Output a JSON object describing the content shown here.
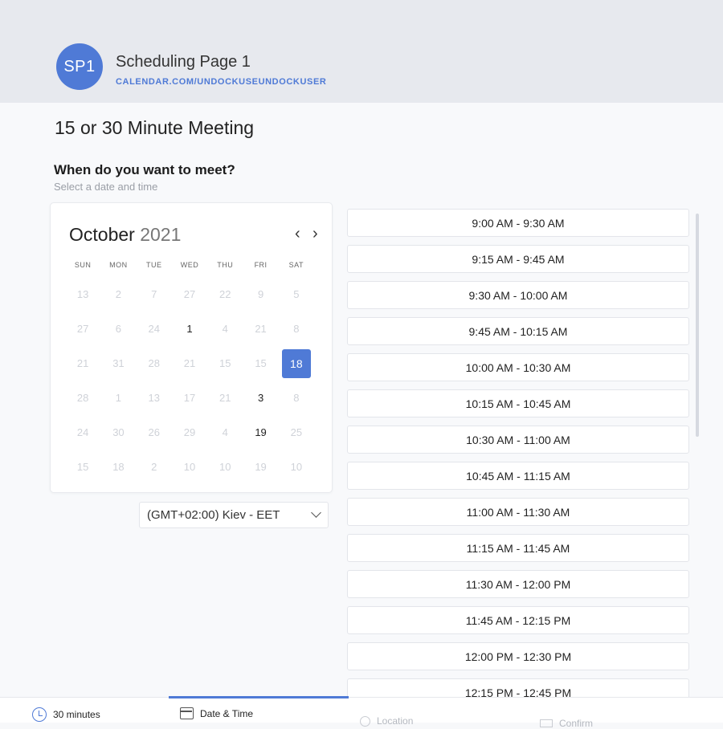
{
  "header": {
    "avatar_initials": "SP1",
    "page_name": "Scheduling Page 1",
    "page_url": "CALENDAR.COM/UNDOCKUSEUNDOCKUSER"
  },
  "meeting": {
    "title": "15 or 30 Minute Meeting",
    "question": "When do you want to meet?",
    "subtitle": "Select a date and time"
  },
  "calendar": {
    "month": "October",
    "year": "2021",
    "weekdays": [
      "SUN",
      "MON",
      "TUE",
      "WED",
      "THU",
      "FRI",
      "SAT"
    ],
    "weeks": [
      [
        {
          "d": "13",
          "s": "off"
        },
        {
          "d": "2",
          "s": "off"
        },
        {
          "d": "7",
          "s": "off"
        },
        {
          "d": "27",
          "s": "off"
        },
        {
          "d": "22",
          "s": "off"
        },
        {
          "d": "9",
          "s": "off"
        },
        {
          "d": "5",
          "s": "off"
        }
      ],
      [
        {
          "d": "27",
          "s": "off"
        },
        {
          "d": "6",
          "s": "off"
        },
        {
          "d": "24",
          "s": "off"
        },
        {
          "d": "1",
          "s": "avail"
        },
        {
          "d": "4",
          "s": "off"
        },
        {
          "d": "21",
          "s": "off"
        },
        {
          "d": "8",
          "s": "off"
        }
      ],
      [
        {
          "d": "21",
          "s": "off"
        },
        {
          "d": "31",
          "s": "off"
        },
        {
          "d": "28",
          "s": "off"
        },
        {
          "d": "21",
          "s": "off"
        },
        {
          "d": "15",
          "s": "off"
        },
        {
          "d": "15",
          "s": "off"
        },
        {
          "d": "18",
          "s": "selected"
        }
      ],
      [
        {
          "d": "28",
          "s": "off"
        },
        {
          "d": "1",
          "s": "off"
        },
        {
          "d": "13",
          "s": "off"
        },
        {
          "d": "17",
          "s": "off"
        },
        {
          "d": "21",
          "s": "off"
        },
        {
          "d": "3",
          "s": "avail"
        },
        {
          "d": "8",
          "s": "off"
        }
      ],
      [
        {
          "d": "24",
          "s": "off"
        },
        {
          "d": "30",
          "s": "off"
        },
        {
          "d": "26",
          "s": "off"
        },
        {
          "d": "29",
          "s": "off"
        },
        {
          "d": "4",
          "s": "off"
        },
        {
          "d": "19",
          "s": "avail"
        },
        {
          "d": "25",
          "s": "off"
        }
      ],
      [
        {
          "d": "15",
          "s": "off"
        },
        {
          "d": "18",
          "s": "off"
        },
        {
          "d": "2",
          "s": "off"
        },
        {
          "d": "10",
          "s": "off"
        },
        {
          "d": "10",
          "s": "off"
        },
        {
          "d": "19",
          "s": "off"
        },
        {
          "d": "10",
          "s": "off"
        }
      ]
    ],
    "prev_icon": "chevron-left-icon",
    "next_icon": "chevron-right-icon"
  },
  "timezone": {
    "selected": "(GMT+02:00) Kiev - EET",
    "icon": "chevron-down-icon"
  },
  "time_slots": [
    "9:00 AM - 9:30 AM",
    "9:15 AM - 9:45 AM",
    "9:30 AM - 10:00 AM",
    "9:45 AM - 10:15 AM",
    "10:00 AM - 10:30 AM",
    "10:15 AM - 10:45 AM",
    "10:30 AM - 11:00 AM",
    "10:45 AM - 11:15 AM",
    "11:00 AM - 11:30 AM",
    "11:15 AM - 11:45 AM",
    "11:30 AM - 12:00 PM",
    "11:45 AM - 12:15 PM",
    "12:00 PM - 12:30 PM",
    "12:15 PM - 12:45 PM"
  ],
  "steps": {
    "duration": "30 minutes",
    "date_time": "Date & Time",
    "location": "Location",
    "confirm": "Confirm"
  },
  "colors": {
    "accent": "#4f7ad6",
    "header_bg": "#e7e9ee",
    "page_bg": "#f8f9fb"
  }
}
